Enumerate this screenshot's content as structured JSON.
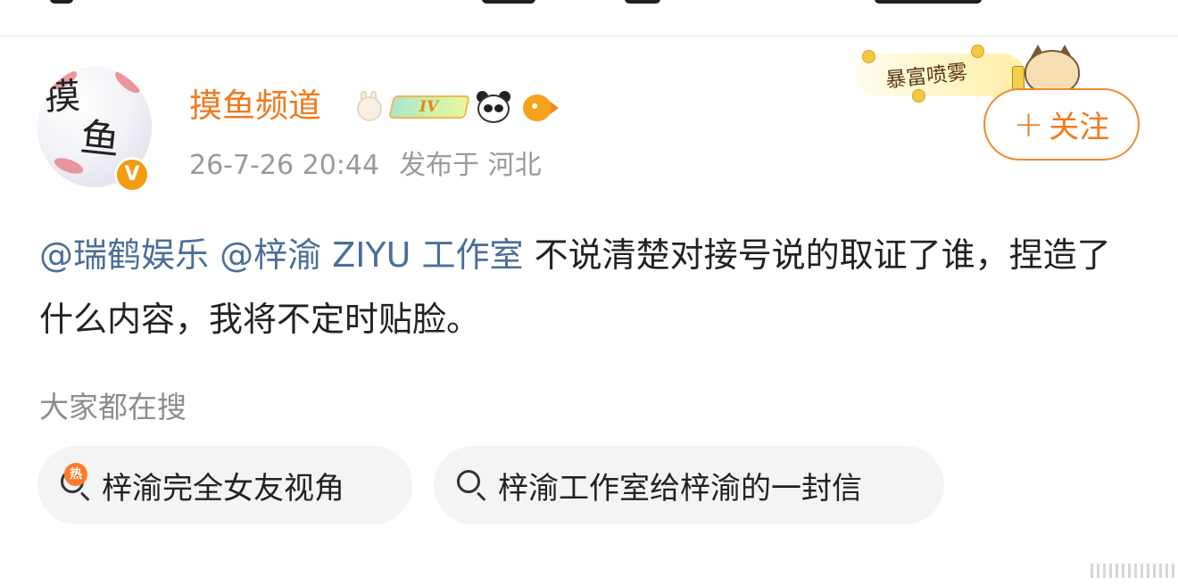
{
  "post": {
    "author": {
      "name": "摸鱼频道",
      "level": "IV",
      "verified_mark": "V",
      "avatar_text_top": "摸",
      "avatar_text_bottom": "鱼"
    },
    "timestamp": "26-7-26 20:44",
    "location": "发布于 河北",
    "decoration": {
      "text": "暴富喷雾"
    },
    "follow_button": {
      "plus": "+",
      "label": "关注"
    },
    "body": {
      "mention_1": "@瑞鹤娱乐",
      "mention_2": "@梓渝 ZIYU 工作室",
      "text": "不说清楚对接号说的取证了谁，捏造了什么内容，我将不定时贴脸。"
    }
  },
  "trending": {
    "title": "大家都在搜",
    "hot_label": "热",
    "items": [
      {
        "label": "梓渝完全女友视角",
        "icon": "hot-search-icon"
      },
      {
        "label": "梓渝工作室给梓渝的一封信",
        "icon": "search-icon"
      }
    ]
  },
  "colors": {
    "accent_orange": "#f07a1e",
    "mention_blue": "#4a6f99",
    "secondary_text": "#9a9a9a",
    "chip_bg": "#f4f4f4"
  }
}
